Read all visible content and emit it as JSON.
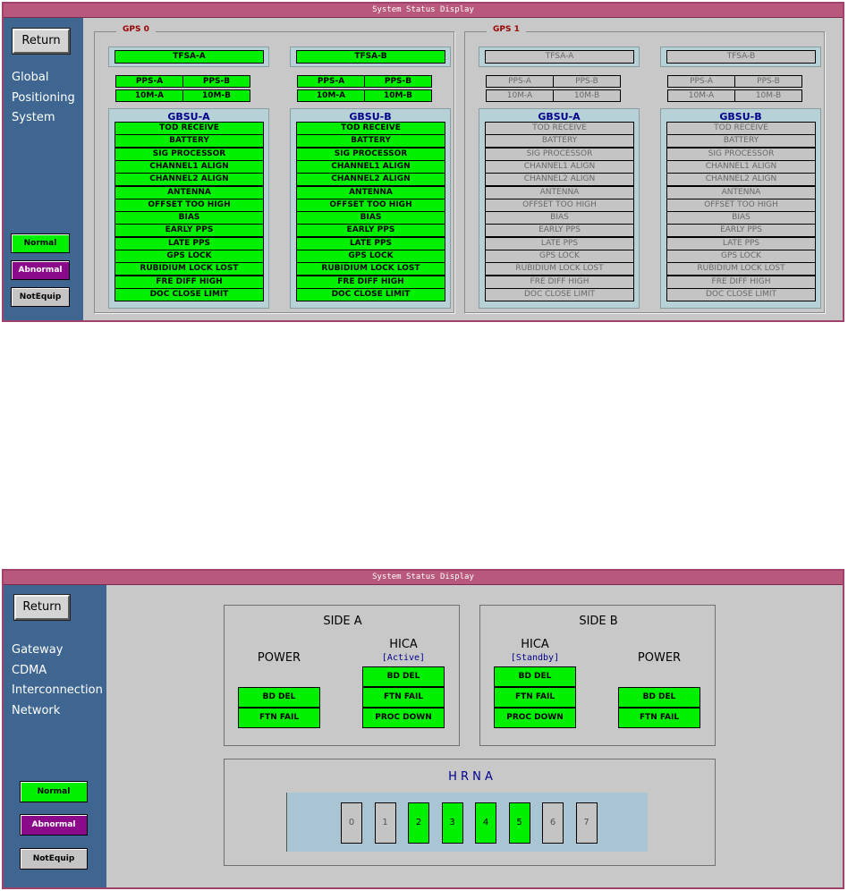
{
  "gps_window": {
    "title": "System Status Display",
    "return_label": "Return",
    "side_title": [
      "Global",
      "Positioning",
      "System"
    ],
    "legend": {
      "normal": "Normal",
      "abnormal": "Abnormal",
      "notequip": "NotEquip"
    },
    "groups": [
      {
        "label": "GPS 0",
        "status": "normal",
        "units": [
          {
            "tfsa": "TFSA-A",
            "pps": [
              "PPS-A",
              "PPS-B"
            ],
            "ten_m": [
              "10M-A",
              "10M-B"
            ],
            "gbsu": "GBSU-A"
          },
          {
            "tfsa": "TFSA-B",
            "pps": [
              "PPS-A",
              "PPS-B"
            ],
            "ten_m": [
              "10M-A",
              "10M-B"
            ],
            "gbsu": "GBSU-B"
          }
        ]
      },
      {
        "label": "GPS 1",
        "status": "notequip",
        "units": [
          {
            "tfsa": "TFSA-A",
            "pps": [
              "PPS-A",
              "PPS-B"
            ],
            "ten_m": [
              "10M-A",
              "10M-B"
            ],
            "gbsu": "GBSU-A"
          },
          {
            "tfsa": "TFSA-B",
            "pps": [
              "PPS-A",
              "PPS-B"
            ],
            "ten_m": [
              "10M-A",
              "10M-B"
            ],
            "gbsu": "GBSU-B"
          }
        ]
      }
    ],
    "alarm_items": [
      "TOD RECEIVE",
      "BATTERY",
      "SIG PROCESSOR",
      "CHANNEL1 ALIGN",
      "CHANNEL2 ALIGN",
      "ANTENNA",
      "OFFSET TOO HIGH",
      "BIAS",
      "EARLY PPS",
      "LATE PPS",
      "GPS LOCK",
      "RUBIDIUM LOCK LOST",
      "FRE DIFF HIGH",
      "DOC CLOSE LIMIT"
    ]
  },
  "gcin_window": {
    "title": "System Status Display",
    "return_label": "Return",
    "side_title": [
      "Gateway",
      "CDMA",
      "Interconnection",
      "Network"
    ],
    "legend": {
      "normal": "Normal",
      "abnormal": "Abnormal",
      "notequip": "NotEquip"
    },
    "side_a": {
      "title": "SIDE A",
      "power": {
        "title": "POWER",
        "items": [
          "BD DEL",
          "FTN FAIL"
        ]
      },
      "hica": {
        "title": "HICA",
        "state": "[Active]",
        "items": [
          "BD DEL",
          "FTN FAIL",
          "PROC DOWN"
        ]
      }
    },
    "side_b": {
      "title": "SIDE B",
      "hica": {
        "title": "HICA",
        "state": "[Standby]",
        "items": [
          "BD DEL",
          "FTN FAIL",
          "PROC DOWN"
        ]
      },
      "power": {
        "title": "POWER",
        "items": [
          "BD DEL",
          "FTN FAIL"
        ]
      }
    },
    "hrna": {
      "title": "H R N A",
      "slots": [
        {
          "label": "0",
          "status": "notequip"
        },
        {
          "label": "1",
          "status": "notequip"
        },
        {
          "label": "2",
          "status": "normal"
        },
        {
          "label": "3",
          "status": "normal"
        },
        {
          "label": "4",
          "status": "normal"
        },
        {
          "label": "5",
          "status": "normal"
        },
        {
          "label": "6",
          "status": "notequip"
        },
        {
          "label": "7",
          "status": "notequip"
        }
      ]
    }
  },
  "colors": {
    "normal": "#00f000",
    "abnormal": "#8a0a8a",
    "notequip": "#c4c4c4",
    "sidebar": "#3e6690",
    "titlebar": "#b9587d",
    "panel": "#b6d2d6"
  }
}
